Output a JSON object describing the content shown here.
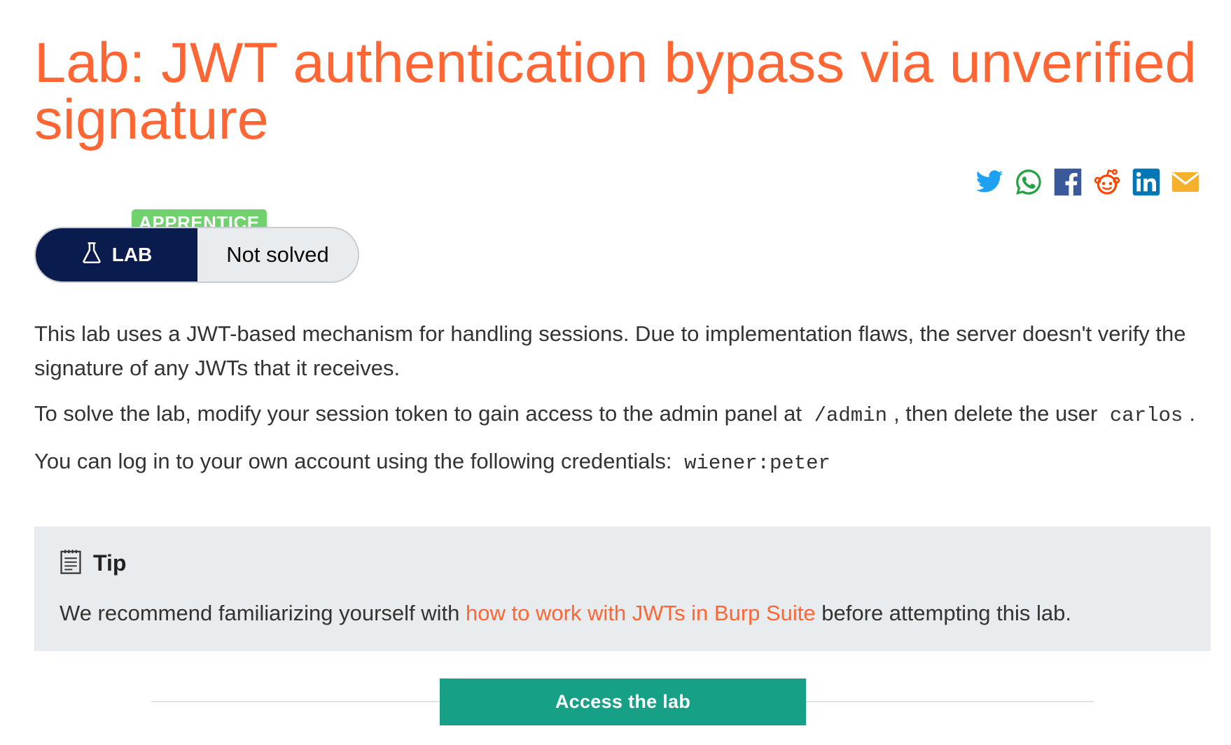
{
  "page": {
    "title": "Lab: JWT authentication bypass via unverified signature"
  },
  "share": {
    "icons": [
      "twitter-icon",
      "whatsapp-icon",
      "facebook-icon",
      "reddit-icon",
      "linkedin-icon",
      "email-icon"
    ],
    "colors": {
      "twitter": "#1da1f2",
      "whatsapp": "#25a244",
      "facebook": "#3b5998",
      "reddit": "#ff4500",
      "linkedin": "#0077b5",
      "email": "#f6b02c"
    }
  },
  "lab": {
    "level": "APPRENTICE",
    "tag": "LAB",
    "status": "Not solved"
  },
  "description": {
    "p1": "This lab uses a JWT-based mechanism for handling sessions. Due to implementation flaws, the server doesn't verify the signature of any JWTs that it receives.",
    "p2_before": "To solve the lab, modify your session token to gain access to the admin panel at",
    "p2_code1": "/admin",
    "p2_middle": ", then delete the user",
    "p2_code2": "carlos",
    "p2_after": ".",
    "p3_before": "You can log in to your own account using the following credentials:",
    "p3_code": "wiener:peter"
  },
  "tip": {
    "title": "Tip",
    "text_before": "We recommend familiarizing yourself with",
    "link": "how to work with JWTs in Burp Suite",
    "text_after": "before attempting this lab."
  },
  "actions": {
    "access": "Access the lab"
  },
  "colors": {
    "accent": "#ff6633",
    "navy": "#0a1c4e",
    "badge_green": "#70d16d",
    "button_teal": "#16a085",
    "panel_grey": "#e8ecef"
  }
}
